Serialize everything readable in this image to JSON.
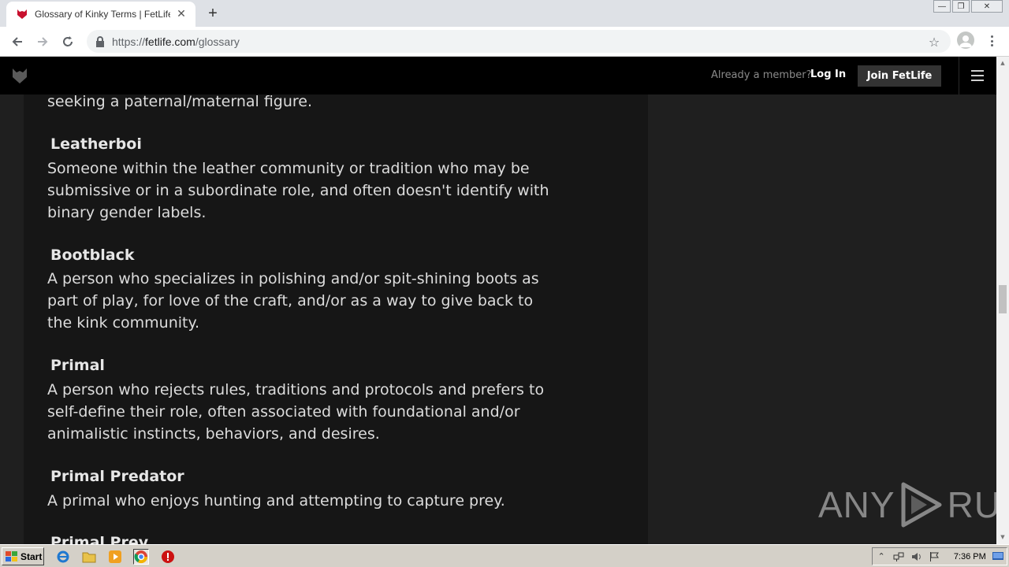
{
  "browser": {
    "tab_title": "Glossary of Kinky Terms | FetLife | F",
    "tab_close": "✕",
    "new_tab": "+",
    "url_prefix": "https://",
    "url_domain": "fetlife.com",
    "url_path": "/glossary",
    "window_controls": {
      "minimize": "—",
      "restore": "❐",
      "close": "✕"
    }
  },
  "header": {
    "already_member": "Already a member?",
    "login_label": "Log In",
    "join_label": "Join FetLife"
  },
  "glossary": {
    "lead_text": "seeking a paternal/maternal figure.",
    "entries": [
      {
        "term": "Leatherboi",
        "definition": "Someone within the leather community or tradition who may be submissive or in a subordinate role, and often doesn't identify with binary gender labels."
      },
      {
        "term": "Bootblack",
        "definition": "A person who specializes in polishing and/or spit-shining boots as part of play, for love of the craft, and/or as a way to give back to the kink community."
      },
      {
        "term": "Primal",
        "definition": "A person who rejects rules, traditions and protocols and prefers to self-define their role, often associated with foundational and/or animalistic instincts, behaviors, and desires."
      },
      {
        "term": "Primal Predator",
        "definition": "A primal who enjoys hunting and attempting to capture prey."
      },
      {
        "term": "Primal Prey",
        "definition": ""
      }
    ]
  },
  "watermark": {
    "left": "ANY",
    "right": "RUN"
  },
  "taskbar": {
    "start_label": "Start",
    "clock": "7:36 PM"
  },
  "colors": {
    "page_bg": "#1f1f1f",
    "panel_bg": "#161616",
    "header_bg": "#000000",
    "text": "#dcdcdc",
    "join_button_bg": "#333333",
    "favicon_red": "#c8102e"
  }
}
